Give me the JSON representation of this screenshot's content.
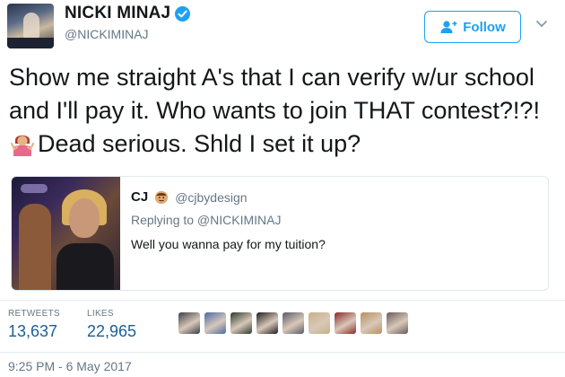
{
  "author": {
    "display_name": "NICKI MINAJ",
    "handle": "@NICKIMINAJ",
    "verified_icon": "verified-badge-icon"
  },
  "follow_button": {
    "label": "Follow",
    "icon": "add-user-icon"
  },
  "menu_icon": "chevron-down-icon",
  "tweet": {
    "text_before_emoji": "Show me straight A's that I can verify w/ur school and I'll pay it. Who wants to join THAT contest?!?!",
    "emoji": "person-shrugging-emoji",
    "text_after_emoji": "Dead serious. Shld I set it up?"
  },
  "quoted_tweet": {
    "name": "CJ",
    "name_emoji": "face-emoji-icon",
    "handle": "@cjbydesign",
    "replying_to": "Replying to @NICKIMINAJ",
    "text": "Well you wanna pay for my tuition?"
  },
  "stats": {
    "retweets_label": "RETWEETS",
    "retweets_value": "13,637",
    "likes_label": "LIKES",
    "likes_value": "22,965"
  },
  "likers": [
    {
      "color": "#3a3f4a"
    },
    {
      "color": "#4a6aa8"
    },
    {
      "color": "#2d3a2d"
    },
    {
      "color": "#1e1e22"
    },
    {
      "color": "#5a5a6a"
    },
    {
      "color": "#c8b088"
    },
    {
      "color": "#8a2a2a"
    },
    {
      "color": "#b89060"
    },
    {
      "color": "#6a5a5a"
    }
  ],
  "timestamp": "9:25 PM - 6 May 2017",
  "colors": {
    "accent": "#1da1f2",
    "text": "#14171a",
    "secondary": "#657786",
    "stat_value": "#1b5f96"
  }
}
